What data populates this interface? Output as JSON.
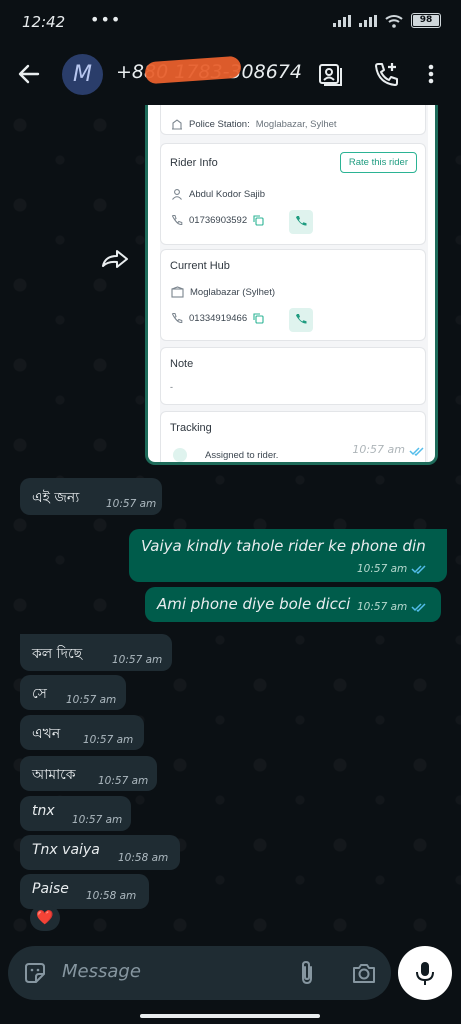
{
  "status_bar": {
    "time": "12:42",
    "dots": "•••",
    "battery": "98"
  },
  "header": {
    "avatar_letter": "M",
    "phone": "+880 1783-308674"
  },
  "card": {
    "police_station_label": "Police Station:",
    "police_station_value": "Moglabazar, Sylhet",
    "rider_info_title": "Rider Info",
    "rate_button": "Rate this rider",
    "rider_name": "Abdul Kodor Sajib",
    "rider_phone": "01736903592",
    "current_hub_title": "Current Hub",
    "hub_name": "Moglabazar (Sylhet)",
    "hub_phone": "01334919466",
    "note_title": "Note",
    "note_value": "-",
    "tracking_title": "Tracking",
    "tracking_status": "Assigned to rider.",
    "time": "10:57 am"
  },
  "messages": [
    {
      "dir": "in",
      "text": "এই জন্য",
      "time": "10:57 am"
    },
    {
      "dir": "out",
      "text": "Vaiya kindly tahole rider ke phone din",
      "time": "10:57 am"
    },
    {
      "dir": "out",
      "text": "Ami phone diye bole dicci",
      "time": "10:57 am"
    },
    {
      "dir": "in",
      "text": "কল দিছে",
      "time": "10:57 am"
    },
    {
      "dir": "in",
      "text": "সে",
      "time": "10:57 am"
    },
    {
      "dir": "in",
      "text": "এখন",
      "time": "10:57 am"
    },
    {
      "dir": "in",
      "text": "আমাকে",
      "time": "10:57 am"
    },
    {
      "dir": "in",
      "text": "tnx",
      "time": "10:57 am"
    },
    {
      "dir": "in",
      "text": "Tnx vaiya",
      "time": "10:58 am"
    },
    {
      "dir": "in",
      "text": "Paise",
      "time": "10:58 am"
    }
  ],
  "reaction": "❤️",
  "input": {
    "placeholder": "Message"
  },
  "colors": {
    "incoming": "#1f2c33",
    "outgoing": "#005c4b",
    "accent": "#25d366",
    "read_ticks": "#53bdeb"
  }
}
